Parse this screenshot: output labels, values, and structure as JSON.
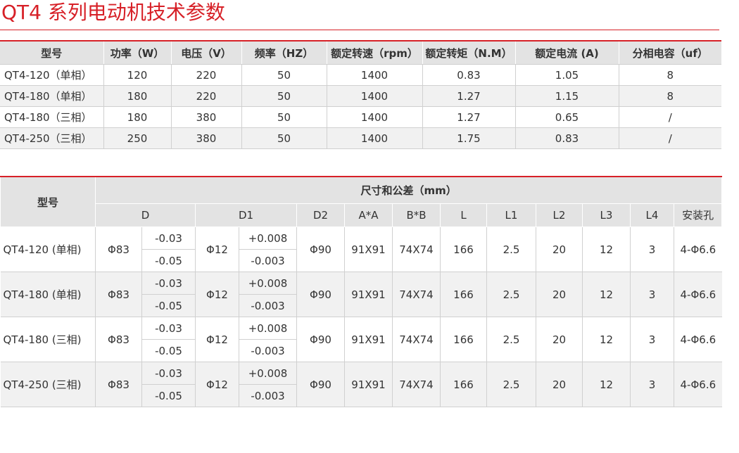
{
  "title": "QT4 系列电动机技术参数",
  "colors": {
    "accent": "#d72027",
    "header_bg": "#e3e3e3",
    "row_alt": "#f1f1f1"
  },
  "table1": {
    "headers": [
      "型号",
      "功率（W）",
      "电压（V）",
      "频率（HZ）",
      "额定转速（rpm）",
      "额定转矩（N.M）",
      "额定电流 (A)",
      "分相电容（uf）"
    ],
    "rows": [
      [
        "QT4-120（单相）",
        "120",
        "220",
        "50",
        "1400",
        "0.83",
        "1.05",
        "8"
      ],
      [
        "QT4-180（单相）",
        "180",
        "220",
        "50",
        "1400",
        "1.27",
        "1.15",
        "8"
      ],
      [
        "QT4-180（三相）",
        "180",
        "380",
        "50",
        "1400",
        "1.27",
        "0.65",
        "/"
      ],
      [
        "QT4-250（三相）",
        "250",
        "380",
        "50",
        "1400",
        "1.75",
        "0.83",
        "/"
      ]
    ]
  },
  "table2": {
    "model_header": "型号",
    "group_header": "尺寸和公差（mm）",
    "sub_headers": [
      "D",
      "D1",
      "D2",
      "A*A",
      "B*B",
      "L",
      "L1",
      "L2",
      "L3",
      "L4",
      "安装孔"
    ],
    "rows": [
      {
        "model": "QT4-120 (单相)",
        "d": "Φ83",
        "d_tol_upper": "-0.03",
        "d_tol_lower": "-0.05",
        "d1": "Φ12",
        "d1_tol_upper": "+0.008",
        "d1_tol_lower": "-0.003",
        "d2": "Φ90",
        "aa": "91X91",
        "bb": "74X74",
        "l": "166",
        "l1": "2.5",
        "l2": "20",
        "l3": "12",
        "l4": "3",
        "hole": "4-Φ6.6"
      },
      {
        "model": "QT4-180 (单相)",
        "d": "Φ83",
        "d_tol_upper": "-0.03",
        "d_tol_lower": "-0.05",
        "d1": "Φ12",
        "d1_tol_upper": "+0.008",
        "d1_tol_lower": "-0.003",
        "d2": "Φ90",
        "aa": "91X91",
        "bb": "74X74",
        "l": "166",
        "l1": "2.5",
        "l2": "20",
        "l3": "12",
        "l4": "3",
        "hole": "4-Φ6.6"
      },
      {
        "model": "QT4-180 (三相)",
        "d": "Φ83",
        "d_tol_upper": "-0.03",
        "d_tol_lower": "-0.05",
        "d1": "Φ12",
        "d1_tol_upper": "+0.008",
        "d1_tol_lower": "-0.003",
        "d2": "Φ90",
        "aa": "91X91",
        "bb": "74X74",
        "l": "166",
        "l1": "2.5",
        "l2": "20",
        "l3": "12",
        "l4": "3",
        "hole": "4-Φ6.6"
      },
      {
        "model": "QT4-250 (三相)",
        "d": "Φ83",
        "d_tol_upper": "-0.03",
        "d_tol_lower": "-0.05",
        "d1": "Φ12",
        "d1_tol_upper": "+0.008",
        "d1_tol_lower": "-0.003",
        "d2": "Φ90",
        "aa": "91X91",
        "bb": "74X74",
        "l": "166",
        "l1": "2.5",
        "l2": "20",
        "l3": "12",
        "l4": "3",
        "hole": "4-Φ6.6"
      }
    ]
  }
}
